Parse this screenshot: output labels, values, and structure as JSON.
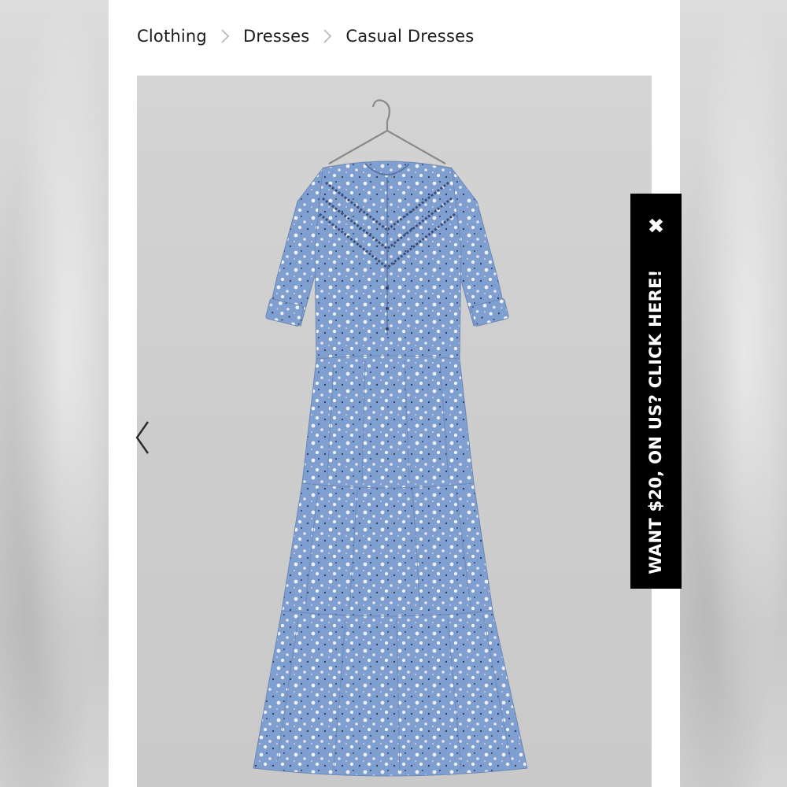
{
  "breadcrumb": {
    "items": [
      "Clothing",
      "Dresses",
      "Casual Dresses"
    ]
  },
  "product": {
    "image_alt": "Blue floral tiered midi dress on hanger",
    "colors": {
      "dress": "#7f9fd0",
      "trim": "#3b4f7a",
      "background": "#cfcfcf"
    }
  },
  "carousel": {
    "prev_icon": "chevron-left-icon"
  },
  "promo": {
    "close_glyph": "✖",
    "label": "WANT $20, ON US? CLICK HERE!"
  }
}
